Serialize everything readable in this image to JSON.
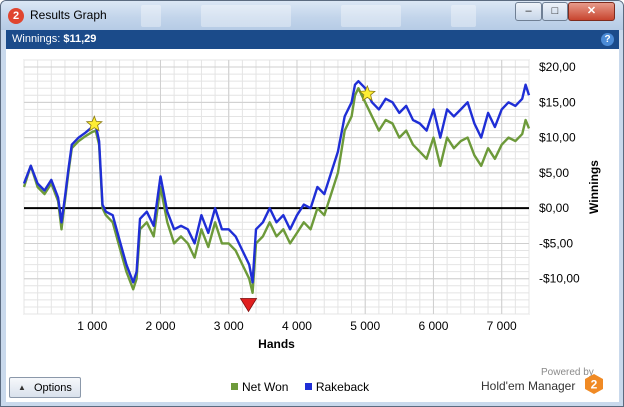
{
  "window": {
    "title": "Results Graph",
    "app_icon_glyph": "2",
    "controls": [
      "minimize",
      "maximize",
      "close"
    ],
    "control_glyphs": {
      "minimize": "–",
      "maximize": "□",
      "close": "✕"
    }
  },
  "header": {
    "label": "Winnings:",
    "value": "$11,29",
    "help_glyph": "?"
  },
  "chart_data": {
    "type": "line",
    "xlabel": "Hands",
    "ylabel": "Winnings",
    "xlim": [
      0,
      7400
    ],
    "ylim": [
      -15,
      21
    ],
    "x_ticks": [
      1000,
      2000,
      3000,
      4000,
      5000,
      6000,
      7000
    ],
    "x_tick_labels": [
      "1 000",
      "2 000",
      "3 000",
      "4 000",
      "5 000",
      "6 000",
      "7 000"
    ],
    "y_ticks": [
      20,
      15,
      10,
      5,
      0,
      -5,
      -10
    ],
    "y_tick_labels": [
      "$20,00",
      "$15,00",
      "$10,00",
      "$5,00",
      "$0,00",
      "-$5,00",
      "-$10,00"
    ],
    "grid": true,
    "zero_line": true,
    "axis_side": "right",
    "series": [
      {
        "name": "Net Won",
        "color": "#6d9a3a",
        "x": [
          0,
          100,
          200,
          300,
          400,
          500,
          550,
          600,
          650,
          700,
          800,
          900,
          1000,
          1050,
          1100,
          1150,
          1200,
          1300,
          1400,
          1500,
          1600,
          1650,
          1700,
          1800,
          1900,
          2000,
          2100,
          2200,
          2300,
          2400,
          2500,
          2600,
          2700,
          2800,
          2900,
          3000,
          3100,
          3200,
          3300,
          3350,
          3400,
          3500,
          3600,
          3700,
          3800,
          3900,
          4000,
          4100,
          4200,
          4300,
          4400,
          4500,
          4600,
          4700,
          4800,
          4850,
          4900,
          5000,
          5100,
          5200,
          5300,
          5400,
          5500,
          5600,
          5700,
          5800,
          5900,
          6000,
          6100,
          6200,
          6300,
          6400,
          6500,
          6600,
          6700,
          6800,
          6900,
          7000,
          7100,
          7200,
          7300,
          7350,
          7400
        ],
        "y": [
          3.0,
          6.0,
          3.0,
          2.0,
          3.5,
          1.0,
          -3.0,
          1.0,
          5.0,
          8.5,
          9.5,
          10.2,
          10.8,
          11.0,
          9.0,
          0.0,
          -1.0,
          -2.0,
          -5.5,
          -9.0,
          -11.5,
          -10.0,
          -3.0,
          -2.0,
          -4.0,
          3.0,
          -2.0,
          -5.0,
          -4.0,
          -5.0,
          -7.0,
          -3.0,
          -5.5,
          -2.0,
          -5.0,
          -5.0,
          -6.0,
          -8.0,
          -10.0,
          -12.0,
          -5.0,
          -4.0,
          -2.0,
          -4.0,
          -3.0,
          -5.0,
          -3.5,
          -2.0,
          -3.0,
          0.0,
          -1.0,
          2.0,
          5.0,
          11.0,
          13.0,
          16.0,
          17.0,
          15.0,
          13.0,
          11.0,
          12.5,
          12.0,
          10.0,
          11.0,
          9.0,
          8.0,
          7.0,
          10.0,
          6.0,
          10.0,
          8.5,
          9.5,
          10.0,
          7.5,
          6.0,
          8.5,
          7.0,
          9.0,
          10.0,
          9.5,
          10.5,
          12.5,
          11.3
        ]
      },
      {
        "name": "Rakeback",
        "color": "#1f2ed6",
        "x": [
          0,
          100,
          200,
          300,
          400,
          500,
          550,
          600,
          650,
          700,
          800,
          900,
          1000,
          1050,
          1100,
          1150,
          1200,
          1300,
          1400,
          1500,
          1600,
          1650,
          1700,
          1800,
          1900,
          2000,
          2100,
          2200,
          2300,
          2400,
          2500,
          2600,
          2700,
          2800,
          2900,
          3000,
          3100,
          3200,
          3300,
          3350,
          3400,
          3500,
          3600,
          3700,
          3800,
          3900,
          4000,
          4100,
          4200,
          4300,
          4400,
          4500,
          4600,
          4700,
          4800,
          4850,
          4900,
          5000,
          5100,
          5200,
          5300,
          5400,
          5500,
          5600,
          5700,
          5800,
          5900,
          6000,
          6100,
          6200,
          6300,
          6400,
          6500,
          6600,
          6700,
          6800,
          6900,
          7000,
          7100,
          7200,
          7300,
          7350,
          7400
        ],
        "y": [
          3.5,
          6.0,
          3.5,
          2.5,
          4.0,
          1.5,
          -2.0,
          1.5,
          5.5,
          9.0,
          10.0,
          10.7,
          11.5,
          11.8,
          9.5,
          0.5,
          -0.5,
          -1.0,
          -4.5,
          -8.0,
          -10.5,
          -9.0,
          -1.5,
          -0.5,
          -2.5,
          4.5,
          -0.5,
          -3.0,
          -2.5,
          -3.0,
          -5.0,
          -1.0,
          -3.5,
          0.0,
          -3.0,
          -3.0,
          -4.0,
          -6.0,
          -8.0,
          -10.5,
          -3.0,
          -2.0,
          0.0,
          -2.0,
          -1.0,
          -3.0,
          -1.0,
          0.5,
          0.0,
          3.0,
          2.0,
          5.0,
          8.0,
          13.0,
          15.0,
          17.5,
          18.0,
          17.0,
          15.0,
          14.0,
          15.5,
          15.0,
          13.5,
          14.5,
          12.5,
          12.0,
          11.0,
          14.0,
          10.0,
          14.0,
          13.0,
          14.0,
          15.0,
          12.0,
          10.0,
          13.5,
          11.5,
          14.0,
          15.0,
          14.5,
          15.5,
          17.5,
          16.0
        ]
      }
    ],
    "markers": [
      {
        "kind": "star",
        "x": 1030,
        "y": 11.9,
        "color": "#ffee33"
      },
      {
        "kind": "star",
        "x": 5030,
        "y": 16.2,
        "color": "#ffee33"
      },
      {
        "kind": "triangle-down",
        "x": 3290,
        "y": -13.8,
        "color": "#e01f1f"
      }
    ]
  },
  "footer": {
    "options_label": "Options",
    "options_glyph": "▲",
    "legend": [
      {
        "label": "Net Won",
        "color": "#6d9a3a"
      },
      {
        "label": "Rakeback",
        "color": "#1f2ed6"
      }
    ],
    "powered_by": "Powered by",
    "brand": "Hold'em Manager",
    "brand_logo_glyph": "2"
  }
}
